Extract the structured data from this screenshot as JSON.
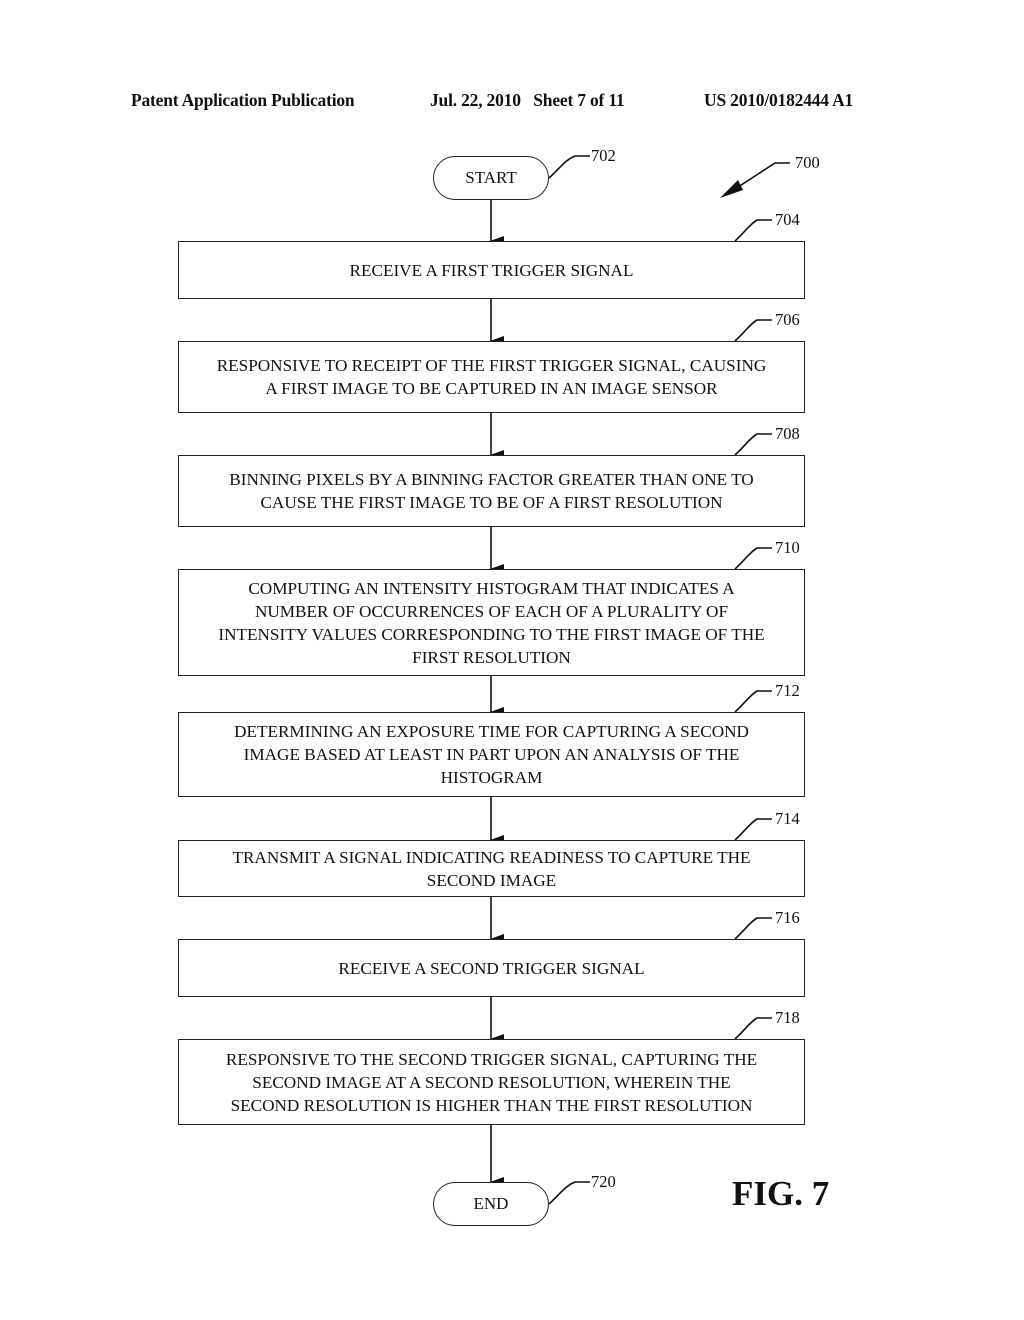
{
  "header": {
    "publication": "Patent Application Publication",
    "date_sheet": "Jul. 22, 2010   Sheet 7 of 11",
    "patent_number": "US 2010/0182444 A1"
  },
  "figure": {
    "label": "FIG. 7",
    "ref": "700"
  },
  "start": {
    "text": "START",
    "ref": "702"
  },
  "steps": [
    {
      "ref": "704",
      "text": "RECEIVE A FIRST TRIGGER SIGNAL"
    },
    {
      "ref": "706",
      "text": "RESPONSIVE TO RECEIPT OF THE FIRST TRIGGER SIGNAL, CAUSING\nA FIRST IMAGE TO BE CAPTURED IN AN IMAGE SENSOR"
    },
    {
      "ref": "708",
      "text": "BINNING PIXELS BY A BINNING FACTOR GREATER THAN ONE TO\nCAUSE THE FIRST IMAGE TO BE OF A FIRST RESOLUTION"
    },
    {
      "ref": "710",
      "text": "COMPUTING AN INTENSITY HISTOGRAM THAT INDICATES A\nNUMBER OF OCCURRENCES OF EACH OF A PLURALITY OF\nINTENSITY VALUES CORRESPONDING TO THE FIRST IMAGE OF THE\nFIRST RESOLUTION"
    },
    {
      "ref": "712",
      "text": "DETERMINING AN EXPOSURE TIME FOR CAPTURING A SECOND\nIMAGE BASED AT LEAST IN PART UPON AN ANALYSIS OF THE\nHISTOGRAM"
    },
    {
      "ref": "714",
      "text": "TRANSMIT A SIGNAL INDICATING READINESS TO CAPTURE THE\nSECOND IMAGE"
    },
    {
      "ref": "716",
      "text": "RECEIVE A SECOND TRIGGER SIGNAL"
    },
    {
      "ref": "718",
      "text": "RESPONSIVE TO THE SECOND TRIGGER SIGNAL, CAPTURING THE\nSECOND IMAGE AT A SECOND RESOLUTION, WHEREIN THE\nSECOND RESOLUTION IS HIGHER THAN THE FIRST RESOLUTION"
    }
  ],
  "end": {
    "text": "END",
    "ref": "720"
  }
}
